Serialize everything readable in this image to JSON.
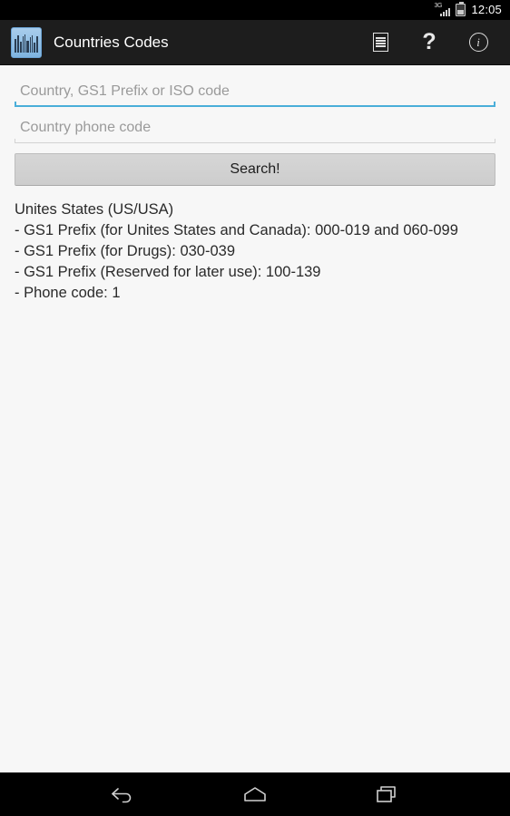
{
  "status_bar": {
    "network_label": "3G",
    "clock": "12:05",
    "icons": [
      "signal-icon",
      "battery-icon"
    ]
  },
  "action_bar": {
    "app_icon": "barcode-app-icon",
    "title": "Countries Codes",
    "actions": [
      {
        "name": "list-icon",
        "label": "List"
      },
      {
        "name": "help-icon",
        "label": "?"
      },
      {
        "name": "info-icon",
        "label": "i"
      }
    ]
  },
  "form": {
    "country_field": {
      "value": "",
      "placeholder": "Country, GS1 Prefix or ISO code",
      "focused": true
    },
    "phone_field": {
      "value": "",
      "placeholder": "Country phone code",
      "focused": false
    },
    "search_button": "Search!"
  },
  "results": {
    "title": "Unites States (US/USA)",
    "lines": [
      " - GS1 Prefix (for Unites States and Canada): 000-019 and 060-099",
      " - GS1 Prefix (for Drugs): 030-039",
      " - GS1 Prefix (Reserved for later use): 100-139",
      " - Phone code: 1"
    ]
  },
  "nav_bar": {
    "buttons": [
      "back-icon",
      "home-icon",
      "recents-icon"
    ]
  },
  "colors": {
    "accent": "#4aaed9",
    "action_bar_bg": "#1d1d1d",
    "content_bg": "#f7f7f7",
    "button_bg": "#d2d2d2",
    "text": "#2a2a2a",
    "placeholder": "#9a9a9a"
  }
}
